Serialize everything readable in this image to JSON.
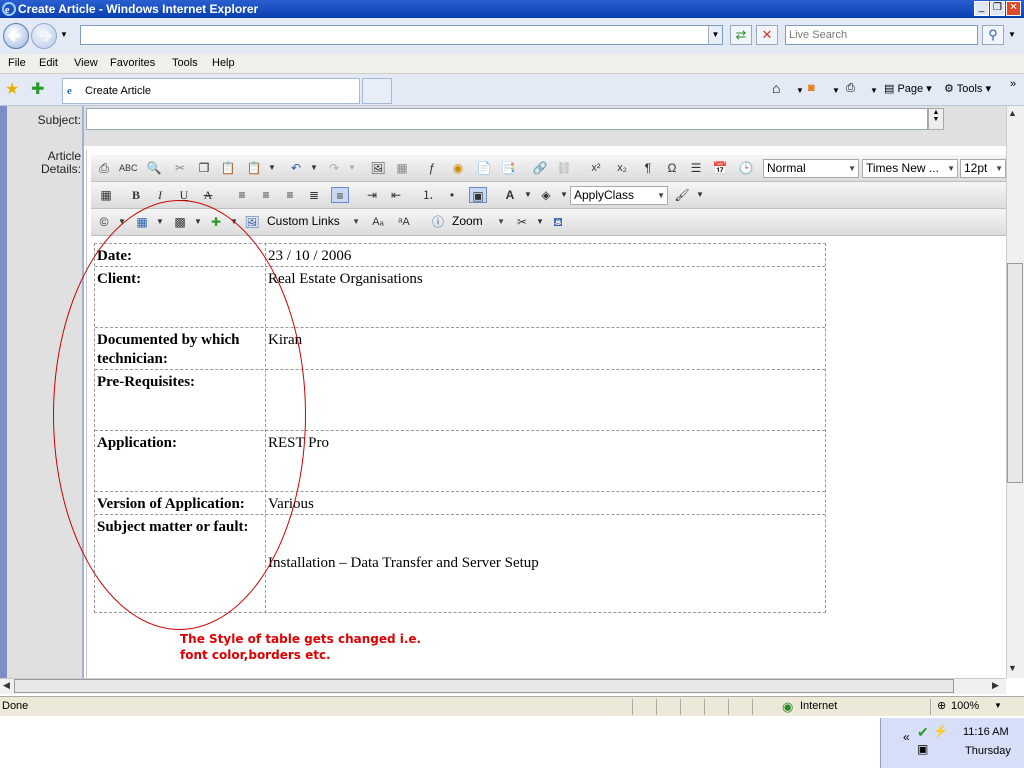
{
  "window": {
    "title": "Create Article - Windows Internet Explorer"
  },
  "browser": {
    "address_value": "",
    "search_placeholder": "Live Search",
    "menu": [
      "File",
      "Edit",
      "View",
      "Favorites",
      "Tools",
      "Help"
    ],
    "tab_title": "Create Article",
    "tools_right": {
      "page": "Page",
      "tools": "Tools"
    }
  },
  "form": {
    "subject_label": "Subject:",
    "subject_value": "",
    "details_label_1": "Article",
    "details_label_2": "Details:"
  },
  "editor_toolbar": {
    "paragraph_style": "Normal",
    "font_name": "Times New ...",
    "font_size": "12pt",
    "apply_class": "ApplyClass",
    "custom_links": "Custom Links",
    "zoom": "Zoom"
  },
  "article_table": {
    "rows": [
      {
        "label": "Date:",
        "value": "23 / 10 / 2006"
      },
      {
        "label": "Client:",
        "value": "Real Estate Organisations"
      },
      {
        "label": "Documented by which technician:",
        "value": "Kiran"
      },
      {
        "label": "Pre-Requisites:",
        "value": ""
      },
      {
        "label": "Application:",
        "value": "REST Pro"
      },
      {
        "label": "Version of Application:",
        "value": "Various"
      },
      {
        "label": "Subject matter or fault:",
        "value": "Installation – Data Transfer and Server Setup"
      }
    ]
  },
  "annotation": {
    "line1": "The Style of table gets changed i.e.",
    "line2": "font color,borders etc."
  },
  "status": {
    "left": "Done",
    "zone": "Internet",
    "zoom": "100%"
  },
  "taskbar": {
    "time": "11:16 AM",
    "day": "Thursday"
  },
  "colors": {
    "annotation": "#dd0000",
    "title_bar": "#0a3fb0"
  }
}
